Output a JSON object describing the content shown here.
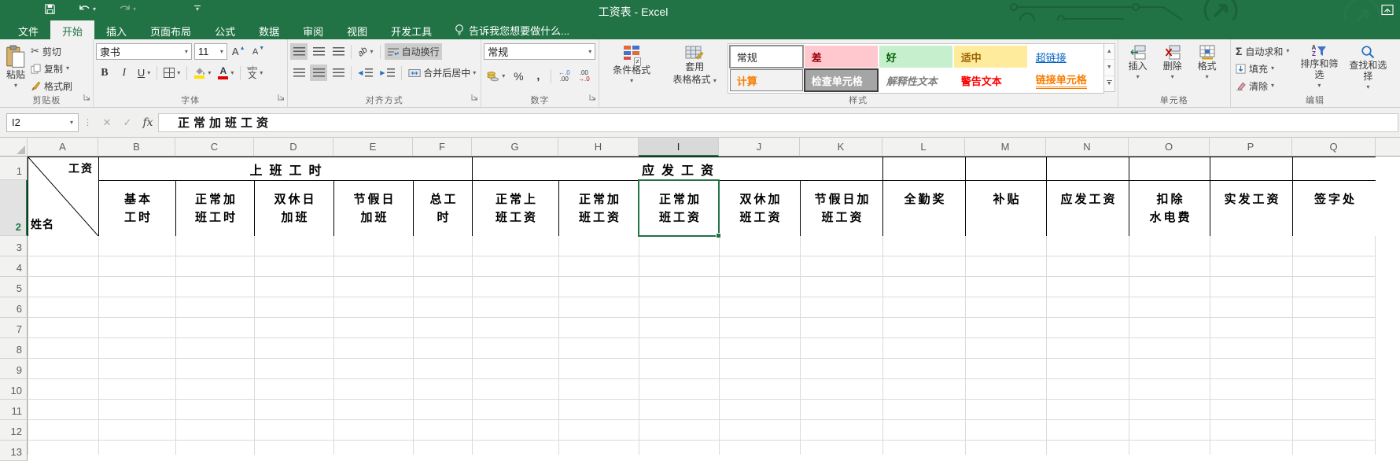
{
  "title_bar": {
    "title": "工资表 - Excel",
    "qat": {
      "save_icon": "floppy-disk",
      "undo_icon": "undo-arrow",
      "redo_icon": "redo-arrow",
      "customize_icon": "caret-down"
    },
    "ribbon_display_icon": "ribbon-display-options"
  },
  "tabs": {
    "items": [
      {
        "key": "file",
        "label": "文件",
        "active": false
      },
      {
        "key": "home",
        "label": "开始",
        "active": true
      },
      {
        "key": "insert",
        "label": "插入",
        "active": false
      },
      {
        "key": "page-layout",
        "label": "页面布局",
        "active": false
      },
      {
        "key": "formulas",
        "label": "公式",
        "active": false
      },
      {
        "key": "data",
        "label": "数据",
        "active": false
      },
      {
        "key": "review",
        "label": "审阅",
        "active": false
      },
      {
        "key": "view",
        "label": "视图",
        "active": false
      },
      {
        "key": "developer",
        "label": "开发工具",
        "active": false
      }
    ],
    "tell_me": "告诉我您想要做什么..."
  },
  "ribbon": {
    "clipboard": {
      "group_label": "剪贴板",
      "paste": "粘贴",
      "cut": "剪切",
      "copy": "复制",
      "format_painter": "格式刷"
    },
    "font": {
      "group_label": "字体",
      "font_name": "隶书",
      "font_size": "11",
      "bold": "B",
      "italic": "I",
      "underline": "U",
      "phonetic_small": "wén",
      "phonetic": "文"
    },
    "alignment": {
      "group_label": "对齐方式",
      "orientation": "ab",
      "wrap_text": "自动换行",
      "merge_center": "合并后居中"
    },
    "number": {
      "group_label": "数字",
      "format": "常规",
      "percent": "%",
      "comma": ",",
      "inc_decimal_top": "←.0",
      "inc_decimal_bot": ".00",
      "dec_decimal_top": ".00",
      "dec_decimal_bot": "→.0"
    },
    "styles": {
      "group_label": "样式",
      "conditional": "条件格式",
      "format_table_line1": "套用",
      "format_table_line2": "表格格式",
      "gallery": [
        {
          "key": "normal",
          "label": "常规"
        },
        {
          "key": "bad",
          "label": "差"
        },
        {
          "key": "good",
          "label": "好"
        },
        {
          "key": "neutral",
          "label": "适中"
        },
        {
          "key": "hyperlink",
          "label": "超链接"
        },
        {
          "key": "calculation",
          "label": "计算"
        },
        {
          "key": "check",
          "label": "检查单元格"
        },
        {
          "key": "explanatory",
          "label": "解释性文本"
        },
        {
          "key": "warning",
          "label": "警告文本"
        },
        {
          "key": "linked",
          "label": "链接单元格"
        }
      ]
    },
    "cells": {
      "group_label": "单元格",
      "insert": "插入",
      "delete": "删除",
      "format": "格式"
    },
    "editing": {
      "group_label": "编辑",
      "sigma": "Σ",
      "autosum": "自动求和",
      "fill": "填充",
      "clear": "清除",
      "sort_filter": "排序和筛选",
      "find_select": "查找和选择"
    }
  },
  "formula_bar": {
    "name_box": "I2",
    "cancel": "✕",
    "enter": "✓",
    "fx": "fx",
    "value": "正常加班工资"
  },
  "sheet": {
    "column_letters": [
      "A",
      "B",
      "C",
      "D",
      "E",
      "F",
      "G",
      "H",
      "I",
      "J",
      "K",
      "L",
      "M",
      "N",
      "O",
      "P",
      "Q"
    ],
    "selected_column": "I",
    "selected_row": 2,
    "selected_cell": "I2",
    "row_numbers": [
      1,
      2,
      3,
      4,
      5,
      6,
      7,
      8,
      9,
      10,
      11,
      12,
      13
    ],
    "header": {
      "diagonal_top": "工资",
      "diagonal_bottom": "姓名",
      "merge_b_f": "上班工时",
      "merge_g_k": "应发工资",
      "row2": [
        {
          "col": "B",
          "line1": "基本",
          "line2": "工时"
        },
        {
          "col": "C",
          "line1": "正常加",
          "line2": "班工时"
        },
        {
          "col": "D",
          "line1": "双休日",
          "line2": "加班"
        },
        {
          "col": "E",
          "line1": "节假日",
          "line2": "加班"
        },
        {
          "col": "F",
          "line1": "总工",
          "line2": "时"
        },
        {
          "col": "G",
          "line1": "正常上",
          "line2": "班工资"
        },
        {
          "col": "H",
          "line1": "正常加",
          "line2": "班工资"
        },
        {
          "col": "I",
          "line1": "正常加",
          "line2": "班工资",
          "selected": true
        },
        {
          "col": "J",
          "line1": "双休加",
          "line2": "班工资"
        },
        {
          "col": "K",
          "line1": "节假日加",
          "line2": "班工资"
        },
        {
          "col": "L",
          "line1": "全勤奖",
          "line2": ""
        },
        {
          "col": "M",
          "line1": "补贴",
          "line2": ""
        },
        {
          "col": "N",
          "line1": "应发工资",
          "line2": ""
        },
        {
          "col": "O",
          "line1": "扣除",
          "line2": "水电费"
        },
        {
          "col": "P",
          "line1": "实发工资",
          "line2": ""
        },
        {
          "col": "Q",
          "line1": "签字处",
          "line2": ""
        }
      ]
    }
  },
  "colors": {
    "excel_green": "#217346",
    "selection_green": "#217346",
    "bad_bg": "#ffc7ce",
    "bad_text": "#9c0006",
    "good_bg": "#c6efce",
    "good_text": "#006100",
    "neutral_bg": "#ffeb9c",
    "neutral_text": "#9c6500",
    "hyperlink_blue": "#0563c1",
    "calc_orange": "#fa7d00",
    "warning_red": "#ff0000",
    "fill_swatch": "#ffe000",
    "font_color_swatch": "#e00000"
  },
  "icons": {
    "save": "floppy",
    "undo": "curved-left-arrow",
    "redo": "curved-right-arrow",
    "lightbulb": "bulb",
    "scissors": "✂",
    "copy": "two-pages",
    "format_painter": "brush",
    "borders": "grid",
    "fill_color": "bucket-yellow",
    "font_color": "A-red",
    "phonetic": "wen-zi",
    "autosum": "Σ",
    "fill_down": "down-arrow-box",
    "clear": "eraser",
    "sort_filter": "AZ-funnel",
    "find_select": "magnifier",
    "insert_cells": "cells-green-arrow",
    "delete_cells": "cells-red-x",
    "format_cells": "cells-blue",
    "conditional_format": "colored-grid-neq",
    "format_as_table": "table-brush",
    "accounting": "coins",
    "select_all": "corner-triangle"
  }
}
